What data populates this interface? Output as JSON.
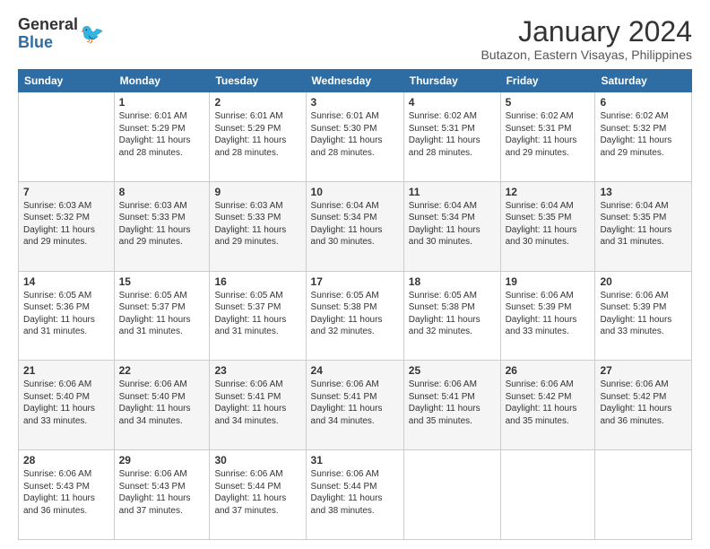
{
  "logo": {
    "general": "General",
    "blue": "Blue"
  },
  "title": "January 2024",
  "subtitle": "Butazon, Eastern Visayas, Philippines",
  "headers": [
    "Sunday",
    "Monday",
    "Tuesday",
    "Wednesday",
    "Thursday",
    "Friday",
    "Saturday"
  ],
  "weeks": [
    [
      {
        "day": "",
        "info": ""
      },
      {
        "day": "1",
        "info": "Sunrise: 6:01 AM\nSunset: 5:29 PM\nDaylight: 11 hours\nand 28 minutes."
      },
      {
        "day": "2",
        "info": "Sunrise: 6:01 AM\nSunset: 5:29 PM\nDaylight: 11 hours\nand 28 minutes."
      },
      {
        "day": "3",
        "info": "Sunrise: 6:01 AM\nSunset: 5:30 PM\nDaylight: 11 hours\nand 28 minutes."
      },
      {
        "day": "4",
        "info": "Sunrise: 6:02 AM\nSunset: 5:31 PM\nDaylight: 11 hours\nand 28 minutes."
      },
      {
        "day": "5",
        "info": "Sunrise: 6:02 AM\nSunset: 5:31 PM\nDaylight: 11 hours\nand 29 minutes."
      },
      {
        "day": "6",
        "info": "Sunrise: 6:02 AM\nSunset: 5:32 PM\nDaylight: 11 hours\nand 29 minutes."
      }
    ],
    [
      {
        "day": "7",
        "info": "Sunrise: 6:03 AM\nSunset: 5:32 PM\nDaylight: 11 hours\nand 29 minutes."
      },
      {
        "day": "8",
        "info": "Sunrise: 6:03 AM\nSunset: 5:33 PM\nDaylight: 11 hours\nand 29 minutes."
      },
      {
        "day": "9",
        "info": "Sunrise: 6:03 AM\nSunset: 5:33 PM\nDaylight: 11 hours\nand 29 minutes."
      },
      {
        "day": "10",
        "info": "Sunrise: 6:04 AM\nSunset: 5:34 PM\nDaylight: 11 hours\nand 30 minutes."
      },
      {
        "day": "11",
        "info": "Sunrise: 6:04 AM\nSunset: 5:34 PM\nDaylight: 11 hours\nand 30 minutes."
      },
      {
        "day": "12",
        "info": "Sunrise: 6:04 AM\nSunset: 5:35 PM\nDaylight: 11 hours\nand 30 minutes."
      },
      {
        "day": "13",
        "info": "Sunrise: 6:04 AM\nSunset: 5:35 PM\nDaylight: 11 hours\nand 31 minutes."
      }
    ],
    [
      {
        "day": "14",
        "info": "Sunrise: 6:05 AM\nSunset: 5:36 PM\nDaylight: 11 hours\nand 31 minutes."
      },
      {
        "day": "15",
        "info": "Sunrise: 6:05 AM\nSunset: 5:37 PM\nDaylight: 11 hours\nand 31 minutes."
      },
      {
        "day": "16",
        "info": "Sunrise: 6:05 AM\nSunset: 5:37 PM\nDaylight: 11 hours\nand 31 minutes."
      },
      {
        "day": "17",
        "info": "Sunrise: 6:05 AM\nSunset: 5:38 PM\nDaylight: 11 hours\nand 32 minutes."
      },
      {
        "day": "18",
        "info": "Sunrise: 6:05 AM\nSunset: 5:38 PM\nDaylight: 11 hours\nand 32 minutes."
      },
      {
        "day": "19",
        "info": "Sunrise: 6:06 AM\nSunset: 5:39 PM\nDaylight: 11 hours\nand 33 minutes."
      },
      {
        "day": "20",
        "info": "Sunrise: 6:06 AM\nSunset: 5:39 PM\nDaylight: 11 hours\nand 33 minutes."
      }
    ],
    [
      {
        "day": "21",
        "info": "Sunrise: 6:06 AM\nSunset: 5:40 PM\nDaylight: 11 hours\nand 33 minutes."
      },
      {
        "day": "22",
        "info": "Sunrise: 6:06 AM\nSunset: 5:40 PM\nDaylight: 11 hours\nand 34 minutes."
      },
      {
        "day": "23",
        "info": "Sunrise: 6:06 AM\nSunset: 5:41 PM\nDaylight: 11 hours\nand 34 minutes."
      },
      {
        "day": "24",
        "info": "Sunrise: 6:06 AM\nSunset: 5:41 PM\nDaylight: 11 hours\nand 34 minutes."
      },
      {
        "day": "25",
        "info": "Sunrise: 6:06 AM\nSunset: 5:41 PM\nDaylight: 11 hours\nand 35 minutes."
      },
      {
        "day": "26",
        "info": "Sunrise: 6:06 AM\nSunset: 5:42 PM\nDaylight: 11 hours\nand 35 minutes."
      },
      {
        "day": "27",
        "info": "Sunrise: 6:06 AM\nSunset: 5:42 PM\nDaylight: 11 hours\nand 36 minutes."
      }
    ],
    [
      {
        "day": "28",
        "info": "Sunrise: 6:06 AM\nSunset: 5:43 PM\nDaylight: 11 hours\nand 36 minutes."
      },
      {
        "day": "29",
        "info": "Sunrise: 6:06 AM\nSunset: 5:43 PM\nDaylight: 11 hours\nand 37 minutes."
      },
      {
        "day": "30",
        "info": "Sunrise: 6:06 AM\nSunset: 5:44 PM\nDaylight: 11 hours\nand 37 minutes."
      },
      {
        "day": "31",
        "info": "Sunrise: 6:06 AM\nSunset: 5:44 PM\nDaylight: 11 hours\nand 38 minutes."
      },
      {
        "day": "",
        "info": ""
      },
      {
        "day": "",
        "info": ""
      },
      {
        "day": "",
        "info": ""
      }
    ]
  ]
}
